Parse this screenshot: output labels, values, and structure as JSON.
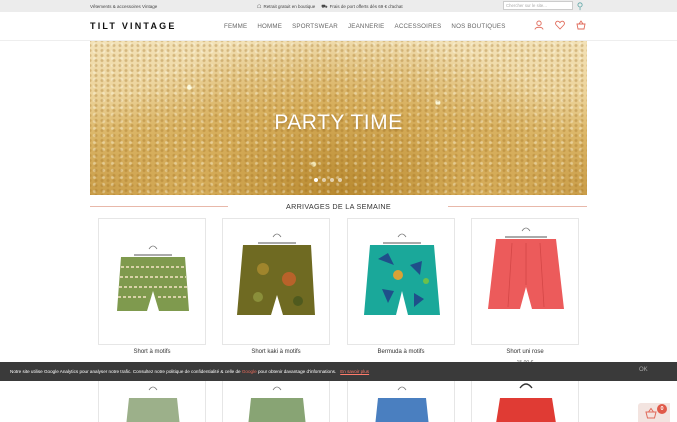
{
  "topbar": {
    "tagline": "Vêtements & accessoires Vintage",
    "info1": "Retrait gratuit en boutique",
    "info2": "Frais de port offerts dès 69 € d'achat",
    "search_placeholder": "Chercher sur le site..."
  },
  "header": {
    "logo": "TILT VINTAGE",
    "nav": [
      "FEMME",
      "HOMME",
      "SPORTSWEAR",
      "JEANNERIE",
      "ACCESSOIRES",
      "NOS BOUTIQUES"
    ]
  },
  "hero": {
    "title": "PARTY TIME",
    "slide_count": 4,
    "active_slide": 1
  },
  "section": {
    "title": "ARRIVAGES DE LA SEMAINE"
  },
  "products": [
    {
      "name": "Short à motifs",
      "color": "#7f9a4e"
    },
    {
      "name": "Short kaki à motifs",
      "color": "#6f6a22"
    },
    {
      "name": "Bermuda à motifs",
      "color": "#1aa89a"
    },
    {
      "name": "Short uni rose",
      "color": "#ec5b5b",
      "price": "15,00 €"
    }
  ],
  "products_row2": [
    {
      "color": "#9cb08a"
    },
    {
      "color": "#88a474"
    },
    {
      "color": "#4a7fc0"
    },
    {
      "color": "#e03b34"
    }
  ],
  "cookie": {
    "text_before": "Notre site utilise Google Analytics pour analyser notre trafic. Consultez notre politique de confidentialité & celle de ",
    "google": "Google",
    "text_after": " pour obtenir davantage d'informations.",
    "more": "En savoir plus",
    "close": "OK"
  },
  "cart": {
    "count": "0"
  },
  "colors": {
    "accent": "#e06a5a",
    "cookie_bg": "#3a3a3a"
  }
}
